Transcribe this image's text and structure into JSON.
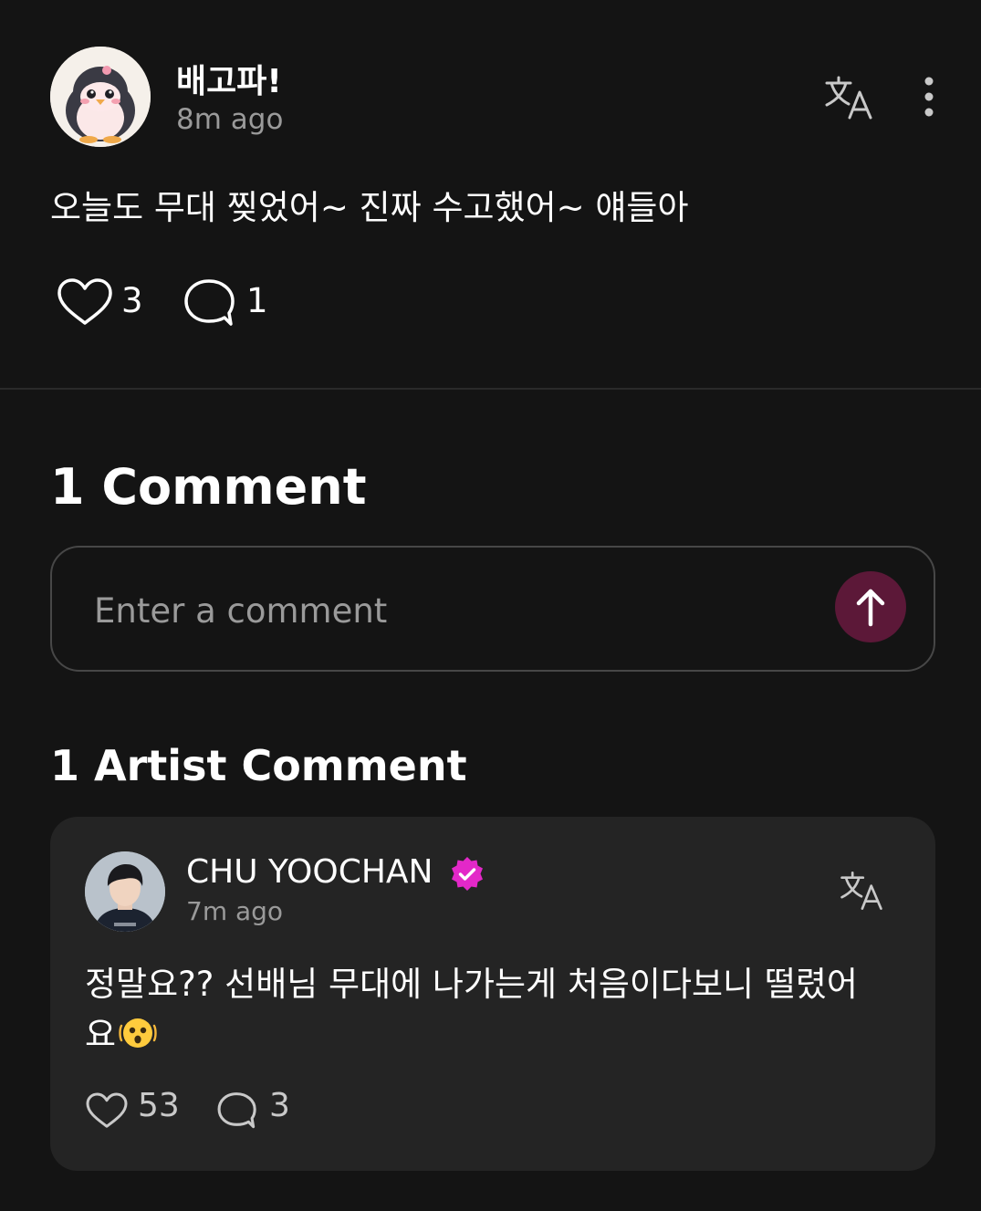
{
  "post": {
    "author": "배고파!",
    "time": "8m ago",
    "body": "오늘도 무대 찢었어~ 진짜 수고했어~ 얘들아",
    "likes": "3",
    "comments": "1",
    "icons": {
      "avatar": "penguin-avatar",
      "translate": "translate-icon",
      "more": "more-vertical-icon",
      "like": "heart-icon",
      "comment": "comment-bubble-icon"
    }
  },
  "comments_section": {
    "title": "1 Comment",
    "input_placeholder": "Enter a comment",
    "send_icon": "arrow-up-icon"
  },
  "artist_section": {
    "title": "1 Artist Comment",
    "comment": {
      "name": "CHU YOOCHAN",
      "time": "7m ago",
      "body": "정말요?? 선배님 무대에 나가는게 처음이다보니 떨렸어요",
      "emoji": "shaking-face-emoji",
      "likes": "53",
      "replies": "3"
    }
  },
  "colors": {
    "background": "#141414",
    "card": "#242424",
    "send_button": "#5c1838",
    "verified": "#e328c8",
    "muted_text": "#9a9a9a"
  }
}
